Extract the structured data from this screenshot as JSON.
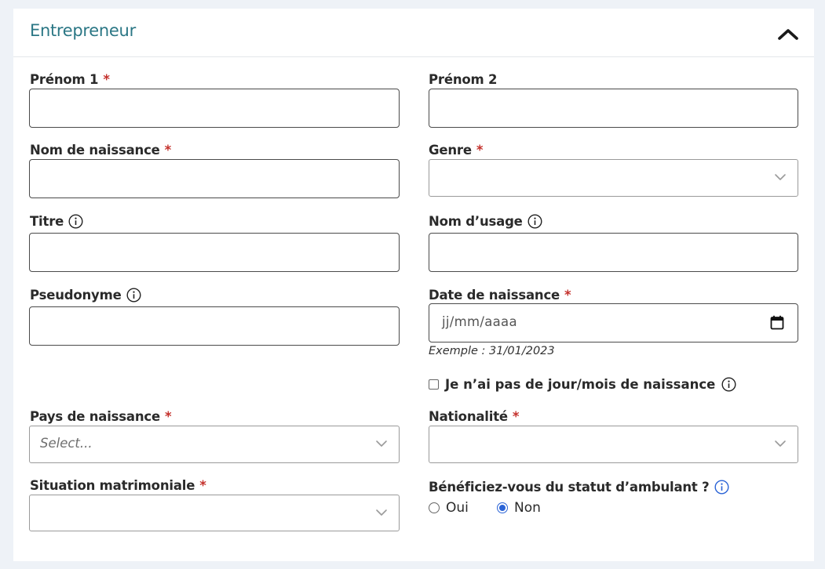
{
  "section": {
    "title": "Entrepreneur",
    "collapse_icon": "chevron-up-icon"
  },
  "required_mark": "*",
  "fields": {
    "prenom1": {
      "label": "Prénom 1",
      "required": true,
      "value": ""
    },
    "prenom2": {
      "label": "Prénom 2",
      "required": false,
      "value": ""
    },
    "nom_naissance": {
      "label": "Nom de naissance",
      "required": true,
      "value": ""
    },
    "genre": {
      "label": "Genre",
      "required": true,
      "value": ""
    },
    "titre": {
      "label": "Titre",
      "required": false,
      "value": "",
      "info_icon": "info-icon"
    },
    "nom_usage": {
      "label": "Nom d’usage",
      "required": false,
      "value": "",
      "info_icon": "info-icon"
    },
    "pseudonyme": {
      "label": "Pseudonyme",
      "required": false,
      "value": "",
      "info_icon": "info-icon"
    },
    "date_naissance": {
      "label": "Date de naissance",
      "required": true,
      "placeholder": "jj/mm/aaaa",
      "hint": "Exemple : 31/01/2023",
      "icon": "calendar-icon"
    },
    "no_day_month": {
      "label": "Je n’ai pas de jour/mois de naissance",
      "checked": false,
      "info_icon": "info-icon"
    },
    "pays_naissance": {
      "label": "Pays de naissance",
      "required": true,
      "placeholder": "Select..."
    },
    "nationalite": {
      "label": "Nationalité",
      "required": true,
      "value": ""
    },
    "situation_matrimoniale": {
      "label": "Situation matrimoniale",
      "required": true,
      "value": ""
    },
    "ambulant": {
      "label": "Bénéficiez-vous du statut d’ambulant ?",
      "info_icon": "info-icon",
      "options": [
        "Oui",
        "Non"
      ],
      "selected": "Non"
    }
  },
  "colors": {
    "title": "#2b7785",
    "required": "#c4302b",
    "radio_selected": "#2a63d6",
    "info_icon_ambulant": "#2a63d6",
    "page_bg": "#eef2f7"
  }
}
